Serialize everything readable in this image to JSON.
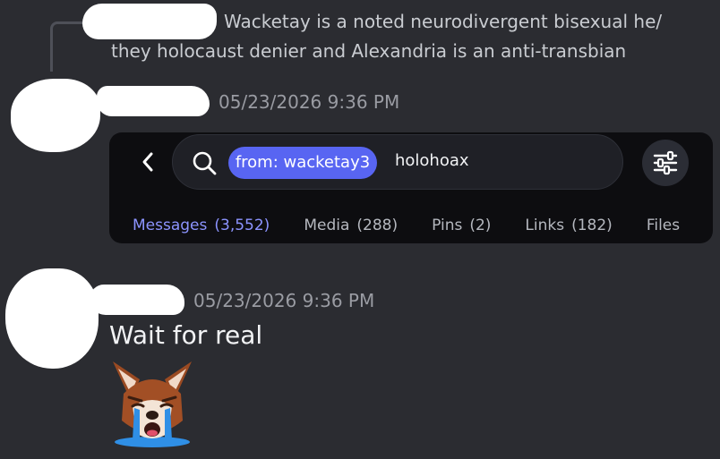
{
  "reply": {
    "text": "Wacketay is a noted neurodivergent bisexual he/ they holocaust denier and Alexandria is an anti-transbian"
  },
  "post1": {
    "timestamp": "05/23/2026 9:36 PM"
  },
  "embed": {
    "search_chip": "from: wacketay3",
    "query": "holohoax",
    "tabs": [
      {
        "label": "Messages",
        "count": "(3,552)"
      },
      {
        "label": "Media",
        "count": "(288)"
      },
      {
        "label": "Pins",
        "count": "(2)"
      },
      {
        "label": "Links",
        "count": "(182)"
      },
      {
        "label": "Files",
        "count": ""
      }
    ]
  },
  "post2": {
    "timestamp": "05/23/2026 9:36 PM",
    "message": "Wait for real",
    "emoji": "crying-wolf-emoji"
  },
  "colors": {
    "background": "#2b2c31",
    "accent": "#5865f2",
    "active_tab": "#8c94ff"
  }
}
